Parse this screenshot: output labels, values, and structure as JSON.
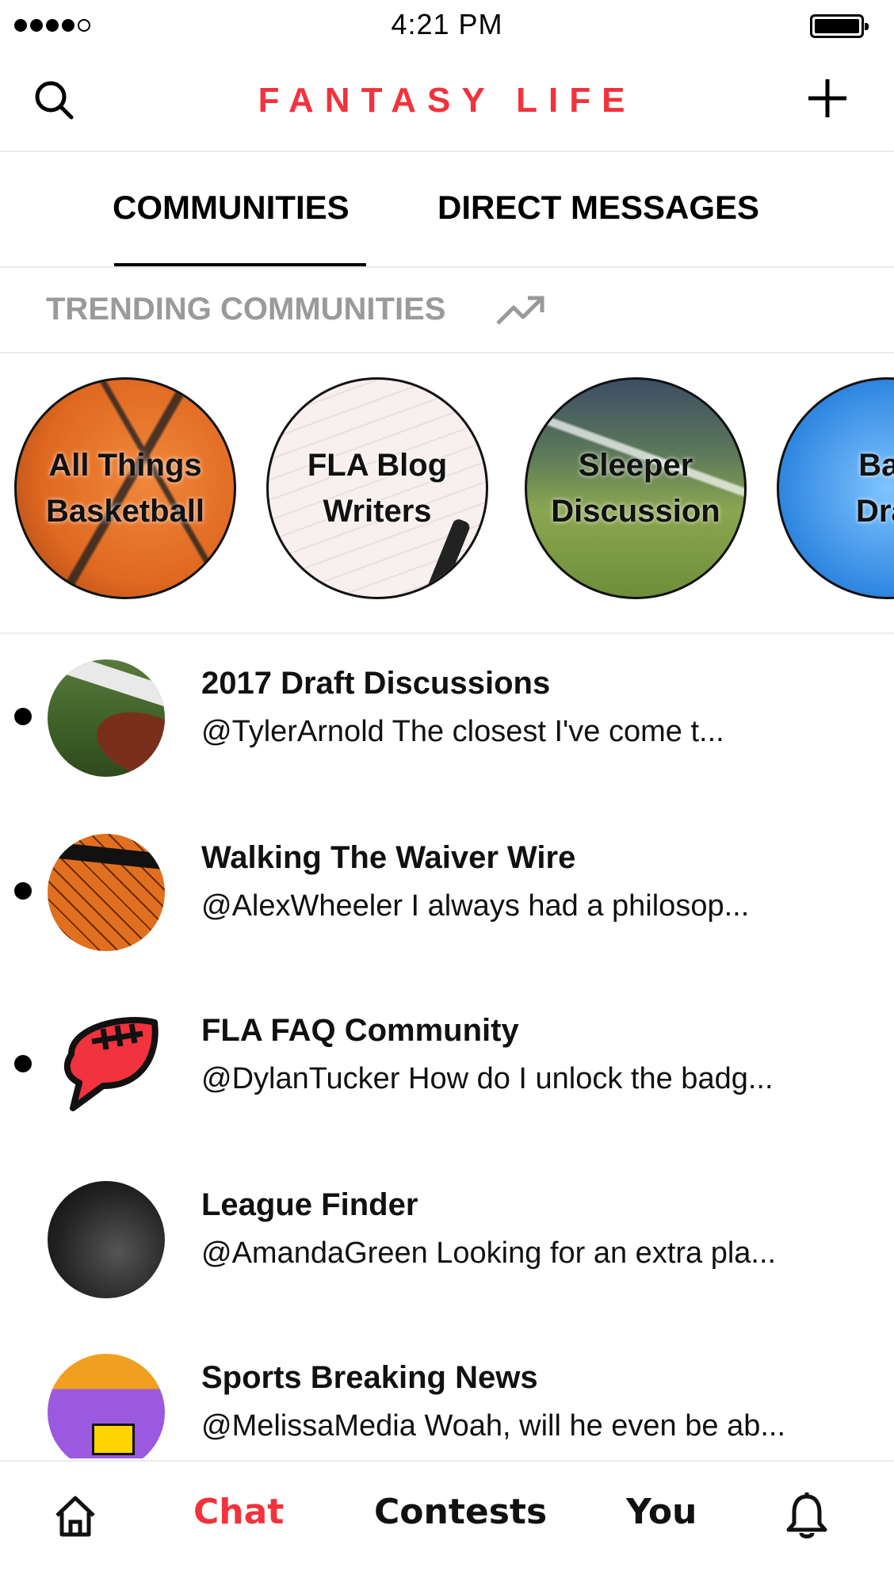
{
  "status_bar": {
    "time": "4:21 PM",
    "signal_bars": 4,
    "signal_total": 5,
    "battery_level": 1.0
  },
  "header": {
    "title": "FANTASY LIFE",
    "title_color": "#f2323c",
    "search_icon": "search-icon",
    "add_icon": "plus-icon"
  },
  "tabs": [
    {
      "label": "COMMUNITIES",
      "active": true
    },
    {
      "label": "DIRECT MESSAGES",
      "active": false
    }
  ],
  "trending": {
    "label": "TRENDING COMMUNITIES",
    "icon": "trending-up-icon",
    "communities": [
      {
        "label_line1": "All Things",
        "label_line2": "Basketball"
      },
      {
        "label_line1": "FLA Blog",
        "label_line2": "Writers"
      },
      {
        "label_line1": "Sleeper",
        "label_line2": "Discussion"
      },
      {
        "label_line1": "Bas",
        "label_line2": "Draf"
      }
    ]
  },
  "communities": [
    {
      "title": "2017 Draft Discussions",
      "message": "@TylerArnold The closest I've come t...",
      "unread": true
    },
    {
      "title": "Walking The Waiver Wire",
      "message": "@AlexWheeler I always had a philosop...",
      "unread": true
    },
    {
      "title": "FLA FAQ Community",
      "message": "@DylanTucker How do I unlock the badg...",
      "unread": true
    },
    {
      "title": "League Finder",
      "message": "@AmandaGreen Looking for an extra pla...",
      "unread": false
    },
    {
      "title": "Sports Breaking News",
      "message": "@MelissaMedia Woah, will he even be ab...",
      "unread": false
    }
  ],
  "bottom_nav": {
    "home_icon": "home-icon",
    "chat": "Chat",
    "contests": "Contests",
    "you": "You",
    "bell_icon": "bell-icon",
    "active": "Chat",
    "active_color": "#f2323c"
  }
}
